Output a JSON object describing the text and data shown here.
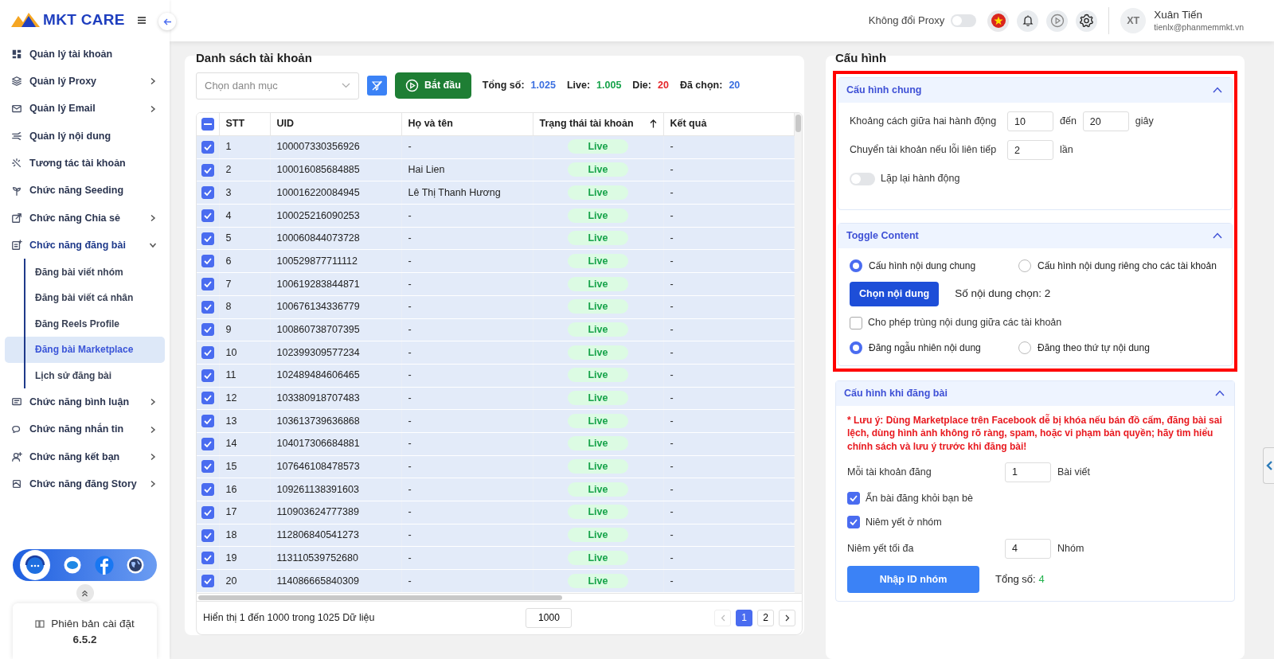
{
  "brand": {
    "name": "MKT CARE"
  },
  "sidebar": {
    "items": [
      {
        "label": "Quản lý tài khoản"
      },
      {
        "label": "Quản lý Proxy",
        "expanded": false
      },
      {
        "label": "Quản lý Email",
        "expanded": false
      },
      {
        "label": "Quản lý nội dung"
      },
      {
        "label": "Tương tác tài khoản"
      },
      {
        "label": "Chức năng Seeding"
      },
      {
        "label": "Chức năng Chia sẻ",
        "expanded": false
      },
      {
        "label": "Chức năng đăng bài",
        "expanded": true,
        "children": [
          {
            "label": "Đăng bài viết nhóm",
            "selected": false
          },
          {
            "label": "Đăng bài viết cá nhân",
            "selected": false
          },
          {
            "label": "Đăng Reels Profile",
            "selected": false
          },
          {
            "label": "Đăng bài Marketplace",
            "selected": true
          },
          {
            "label": "Lịch sử đăng bài",
            "selected": false
          }
        ]
      },
      {
        "label": "Chức năng bình luận",
        "expanded": false
      },
      {
        "label": "Chức năng nhắn tin",
        "expanded": false
      },
      {
        "label": "Chức năng kết bạn",
        "expanded": false
      },
      {
        "label": "Chức năng đăng Story",
        "expanded": false
      }
    ],
    "version": {
      "label": "Phiên bản cài đặt",
      "value": "6.5.2"
    }
  },
  "header": {
    "proxy_switch": {
      "label": "Không đổi Proxy",
      "on": false
    },
    "user": {
      "initials": "XT",
      "name": "Xuân Tiến",
      "email": "tienlx@phanmemmkt.vn"
    }
  },
  "accounts": {
    "title": "Danh sách tài khoản",
    "category_placeholder": "Chọn danh mục",
    "start_button": "Bắt đầu",
    "stats": [
      {
        "label": "Tổng số:",
        "value": "1.025",
        "color": "#3b6fe0"
      },
      {
        "label": "Live:",
        "value": "1.005",
        "color": "#16a34a"
      },
      {
        "label": "Die:",
        "value": "20",
        "color": "#e5262a"
      },
      {
        "label": "Đã chọn:",
        "value": "20",
        "color": "#3b6fe0"
      }
    ],
    "table": {
      "select_all": {
        "checked": true,
        "partial": true
      },
      "columns": [
        {
          "label": "STT",
          "sorted": false
        },
        {
          "label": "UID",
          "sorted": false
        },
        {
          "label": "Họ và tên",
          "sorted": false
        },
        {
          "label": "Trạng thái tài khoản",
          "sorted": true
        },
        {
          "label": "Kết quả",
          "sorted": false
        }
      ],
      "rows": [
        {
          "stt": "1",
          "uid": "100007330356926",
          "name": "-",
          "status": "Live",
          "result": "-",
          "selected": true
        },
        {
          "stt": "2",
          "uid": "100016085684885",
          "name": "Hai Lien",
          "status": "Live",
          "result": "-",
          "selected": true
        },
        {
          "stt": "3",
          "uid": "100016220084945",
          "name": "Lê Thị Thanh Hương",
          "status": "Live",
          "result": "-",
          "selected": true
        },
        {
          "stt": "4",
          "uid": "100025216090253",
          "name": "-",
          "status": "Live",
          "result": "-",
          "selected": true
        },
        {
          "stt": "5",
          "uid": "100060844073728",
          "name": "-",
          "status": "Live",
          "result": "-",
          "selected": true
        },
        {
          "stt": "6",
          "uid": "100529877711112",
          "name": "-",
          "status": "Live",
          "result": "-",
          "selected": true
        },
        {
          "stt": "7",
          "uid": "100619283844871",
          "name": "-",
          "status": "Live",
          "result": "-",
          "selected": true
        },
        {
          "stt": "8",
          "uid": "100676134336779",
          "name": "-",
          "status": "Live",
          "result": "-",
          "selected": true
        },
        {
          "stt": "9",
          "uid": "100860738707395",
          "name": "-",
          "status": "Live",
          "result": "-",
          "selected": true
        },
        {
          "stt": "10",
          "uid": "102399309577234",
          "name": "-",
          "status": "Live",
          "result": "-",
          "selected": true
        },
        {
          "stt": "11",
          "uid": "102489484606465",
          "name": "-",
          "status": "Live",
          "result": "-",
          "selected": true
        },
        {
          "stt": "12",
          "uid": "103380918707483",
          "name": "-",
          "status": "Live",
          "result": "-",
          "selected": true
        },
        {
          "stt": "13",
          "uid": "103613739636868",
          "name": "-",
          "status": "Live",
          "result": "-",
          "selected": true
        },
        {
          "stt": "14",
          "uid": "104017306684881",
          "name": "-",
          "status": "Live",
          "result": "-",
          "selected": true
        },
        {
          "stt": "15",
          "uid": "107646108478573",
          "name": "-",
          "status": "Live",
          "result": "-",
          "selected": true
        },
        {
          "stt": "16",
          "uid": "109261138391603",
          "name": "-",
          "status": "Live",
          "result": "-",
          "selected": true
        },
        {
          "stt": "17",
          "uid": "110903624777389",
          "name": "-",
          "status": "Live",
          "result": "-",
          "selected": true
        },
        {
          "stt": "18",
          "uid": "112806840541273",
          "name": "-",
          "status": "Live",
          "result": "-",
          "selected": true
        },
        {
          "stt": "19",
          "uid": "113110539752680",
          "name": "-",
          "status": "Live",
          "result": "-",
          "selected": true
        },
        {
          "stt": "20",
          "uid": "114086665840309",
          "name": "-",
          "status": "Live",
          "result": "-",
          "selected": true
        }
      ]
    },
    "footer": {
      "summary": "Hiển thị 1 đến 1000 trong 1025 Dữ liệu",
      "page_size": "1000",
      "pages": [
        {
          "label": "1",
          "selected": true
        },
        {
          "label": "2",
          "selected": false
        }
      ],
      "prev_disabled": true
    }
  },
  "config": {
    "title": "Cấu hình",
    "sections": [
      {
        "title": "Cấu hình chung",
        "expanded": true,
        "highlighted": true,
        "items": [
          {
            "kind": "range",
            "label": "Khoảng cách giữa hai hành động",
            "from": "10",
            "separator": "đến",
            "to": "20",
            "unit": "giây"
          },
          {
            "kind": "number",
            "label": "Chuyển tài khoản nếu lỗi liên tiếp",
            "value": "2",
            "unit": "lần"
          },
          {
            "kind": "switch",
            "label": "Lặp lại hành động",
            "on": false
          }
        ]
      },
      {
        "title": "Toggle Content",
        "expanded": true,
        "highlighted": true,
        "items": [
          {
            "kind": "radios",
            "options": [
              {
                "label": "Cấu hình nội dung chung",
                "selected": true
              },
              {
                "label": "Cấu hình nội dung riêng cho các tài khoản",
                "selected": false
              }
            ]
          },
          {
            "kind": "picker",
            "label": "Chọn nội dung",
            "note": "Số nội dung chọn: 2"
          },
          {
            "kind": "checkbox",
            "label": "Cho phép trùng nội dung giữa các tài khoản",
            "checked": false
          },
          {
            "kind": "radios",
            "options": [
              {
                "label": "Đăng ngẫu nhiên nội dung",
                "selected": true
              },
              {
                "label": "Đăng theo thứ tự nội dung",
                "selected": false
              }
            ]
          }
        ]
      },
      {
        "title": "Cấu hình khi đăng bài",
        "expanded": true,
        "highlighted": false,
        "items": [
          {
            "kind": "warning",
            "text": "* Lưu ý: Dùng Marketplace trên Facebook dễ bị khóa nếu bán đồ cấm, đăng bài sai lệch, dùng hình ảnh không rõ ràng, spam, hoặc vi phạm bản quyền; hãy tìm hiểu chính sách và lưu ý trước khi đăng bài!"
          },
          {
            "kind": "number",
            "label": "Mỗi tài khoản đăng",
            "value": "1",
            "unit": "Bài viết"
          },
          {
            "kind": "checkbox",
            "label": "Ẩn bài đăng khỏi bạn bè",
            "checked": true
          },
          {
            "kind": "checkbox",
            "label": "Niêm yết ở nhóm",
            "checked": true
          },
          {
            "kind": "number",
            "label": "Niêm yết tối đa",
            "value": "4",
            "unit": "Nhóm"
          },
          {
            "kind": "importer",
            "label": "Nhập ID nhóm",
            "note_label": "Tổng số:",
            "note_value": "4"
          }
        ]
      }
    ]
  }
}
